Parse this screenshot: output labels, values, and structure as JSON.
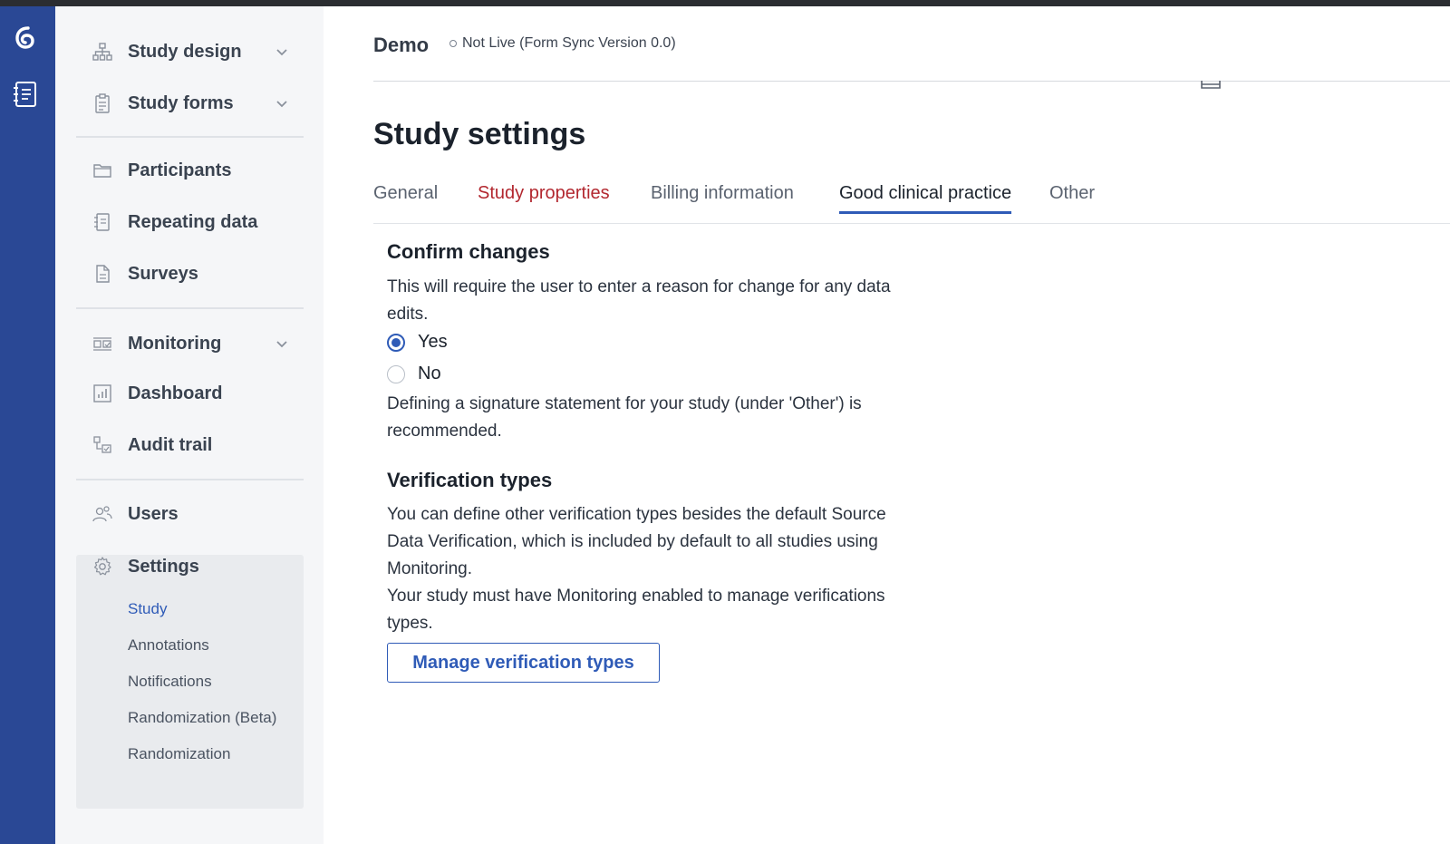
{
  "sidebar": {
    "items": [
      {
        "label": "Study design",
        "icon": "sitemap-icon"
      },
      {
        "label": "Study forms",
        "icon": "form-icon"
      },
      {
        "label": "Participants",
        "icon": "folder-icon"
      },
      {
        "label": "Repeating data",
        "icon": "list-icon"
      },
      {
        "label": "Surveys",
        "icon": "survey-icon"
      },
      {
        "label": "Monitoring",
        "icon": "monitoring-icon"
      },
      {
        "label": "Dashboard",
        "icon": "chart-icon"
      },
      {
        "label": "Audit trail",
        "icon": "audit-icon"
      },
      {
        "label": "Users",
        "icon": "users-icon"
      },
      {
        "label": "Settings",
        "icon": "gear-icon"
      }
    ],
    "settings_sub": [
      "Study",
      "Annotations",
      "Notifications",
      "Randomization (Beta)",
      "Randomization"
    ]
  },
  "header": {
    "study_name": "Demo",
    "status": "Not Live (Form Sync Version 0.0)"
  },
  "page": {
    "title": "Study settings",
    "tabs": [
      "General",
      "Study properties",
      "Billing information",
      "Good clinical practice",
      "Other"
    ]
  },
  "confirm": {
    "title": "Confirm changes",
    "description": "This will require the user to enter a reason for change for any data edits.",
    "yes": "Yes",
    "no": "No",
    "note": "Defining a signature statement for your study (under 'Other') is recommended."
  },
  "verification": {
    "title": "Verification types",
    "description": "You can define other verification types besides the default Source Data Verification, which is included by default to all studies using Monitoring.",
    "note": "Your study must have Monitoring enabled to manage verifications types.",
    "button": "Manage verification types"
  },
  "colors": {
    "rail": "#2a4895",
    "accent": "#2f5bb7",
    "warning_tab": "#b2272f"
  }
}
